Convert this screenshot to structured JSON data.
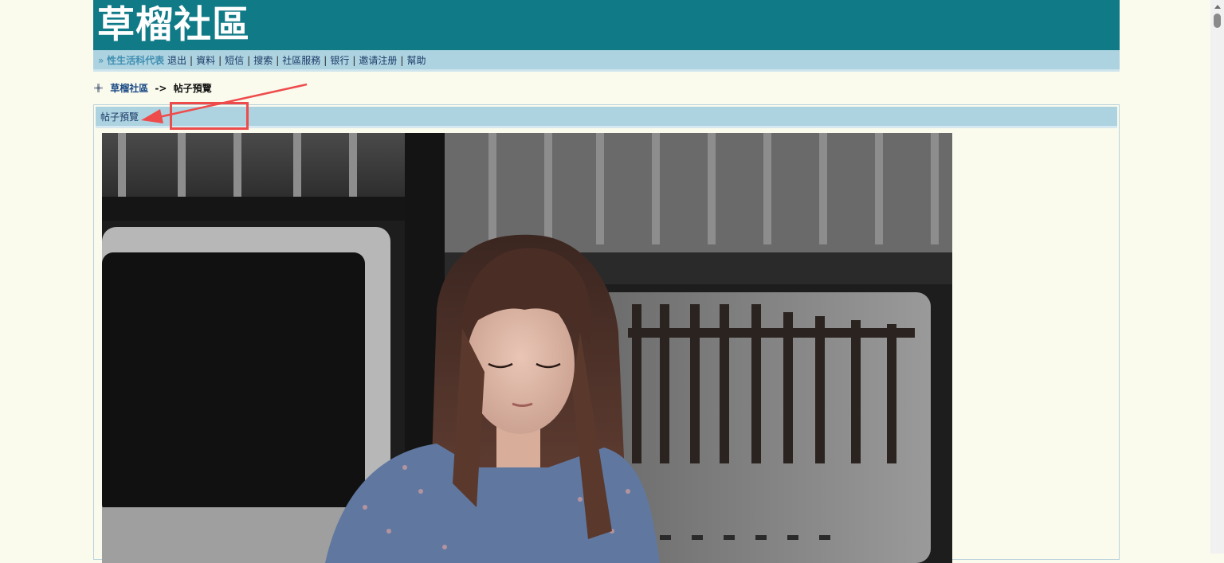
{
  "header": {
    "site_title": "草榴社區",
    "background": "#107a87"
  },
  "nav": {
    "prefix": "»",
    "username": "性生活科代表",
    "links": [
      "退出",
      "資料",
      "短信",
      "搜索",
      "社區服務",
      "银行",
      "邀请注册",
      "幫助"
    ],
    "separator": "|"
  },
  "breadcrumb": {
    "icon": "forum-icon",
    "home": "草榴社區",
    "arrow": "->",
    "current": "帖子預覽"
  },
  "panel": {
    "header": "帖子預覽"
  },
  "photo": {
    "description_icon": "post-photo"
  },
  "annotation": {
    "color": "#ee4b4b"
  },
  "colors": {
    "page_bg": "#fafaed",
    "nav_bg": "#add2e0",
    "link": "#1b4a86"
  }
}
